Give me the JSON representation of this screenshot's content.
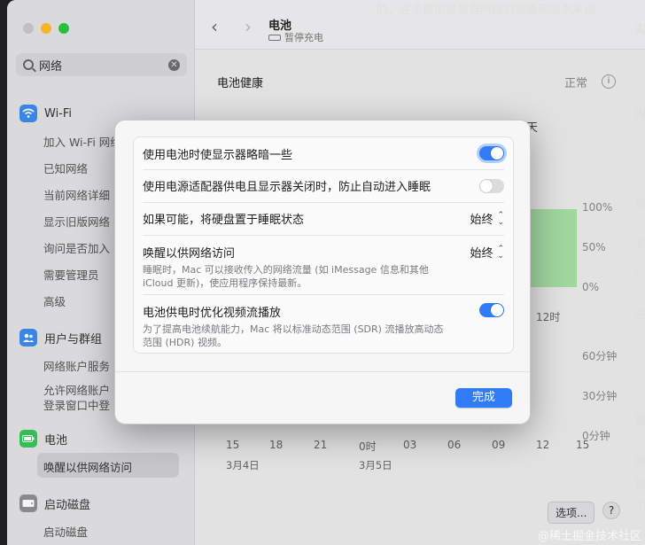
{
  "sidebar": {
    "search_value": "网络",
    "groups": [
      {
        "label": "Wi-Fi",
        "icon": "wifi-icon",
        "color": "#3d8cf0",
        "items": [
          "加入 Wi-Fi 网络",
          "已知网络",
          "当前网络详细",
          "显示旧版网络",
          "询问是否加入",
          "需要管理员",
          "高级"
        ]
      },
      {
        "label": "用户与群组",
        "icon": "users-icon",
        "color": "#3d8cf0",
        "items": [
          "网络账户服务",
          "允许网络账户",
          "登录窗口中登"
        ]
      },
      {
        "label": "电池",
        "icon": "battery-icon",
        "color": "#34c759",
        "items": [
          "唤醒以供网络访问"
        ]
      },
      {
        "label": "启动磁盘",
        "icon": "disk-icon",
        "color": "#8e8e93",
        "items": [
          "启动磁盘"
        ]
      }
    ]
  },
  "header": {
    "title": "电池",
    "subtitle": "暂停充电"
  },
  "main": {
    "health_label": "电池健康",
    "health_value": "正常",
    "tab_fragment": "天",
    "pct_labels": [
      "100%",
      "50%",
      "0%"
    ],
    "x_labels_top": [
      "12时"
    ],
    "mins_labels": [
      "60分钟",
      "30分钟",
      "0分钟"
    ],
    "x_labels": [
      "15",
      "18",
      "21",
      "0时",
      "03",
      "06",
      "09",
      "12",
      "15"
    ],
    "dates": [
      "3月4日",
      "3月5日"
    ],
    "options_label": "选项...",
    "help_label": "?"
  },
  "sheet": {
    "rows": [
      {
        "label": "使用电池时使显示器略暗一些",
        "control": "toggle",
        "on": true
      },
      {
        "label": "使用电源适配器供电且显示器关闭时，防止自动进入睡眠",
        "control": "toggle",
        "on": false
      },
      {
        "label": "如果可能，将硬盘置于睡眠状态",
        "control": "popup",
        "value": "始终"
      },
      {
        "label": "唤醒以供网络访问",
        "desc": "睡眠时，Mac 可以接收传入的网络流量 (如 iMessage 信息和其他 iCloud 更新)，使应用程序保持最新。",
        "control": "popup",
        "value": "始终"
      },
      {
        "label": "电池供电时优化视频流播放",
        "desc": "为了提高电池续航能力，Mac 将以标准动态范围 (SDR) 流播放高动态范围 (HDR) 视频。",
        "control": "toggle",
        "on": true
      }
    ],
    "done_label": "完成"
  },
  "background_edge": {
    "top_text": "的，这个截图是根据网络的规模和需求来设",
    "right_chars": [
      "实",
      "内",
      "用",
      "2",
      "。",
      "空",
      "重",
      "前",
      "设",
      "个"
    ]
  },
  "watermark": "@稀土掘金技术社区",
  "colors": {
    "accent": "#2f7cf6",
    "green": "#a8dfa6",
    "battery_green": "#34c759"
  }
}
